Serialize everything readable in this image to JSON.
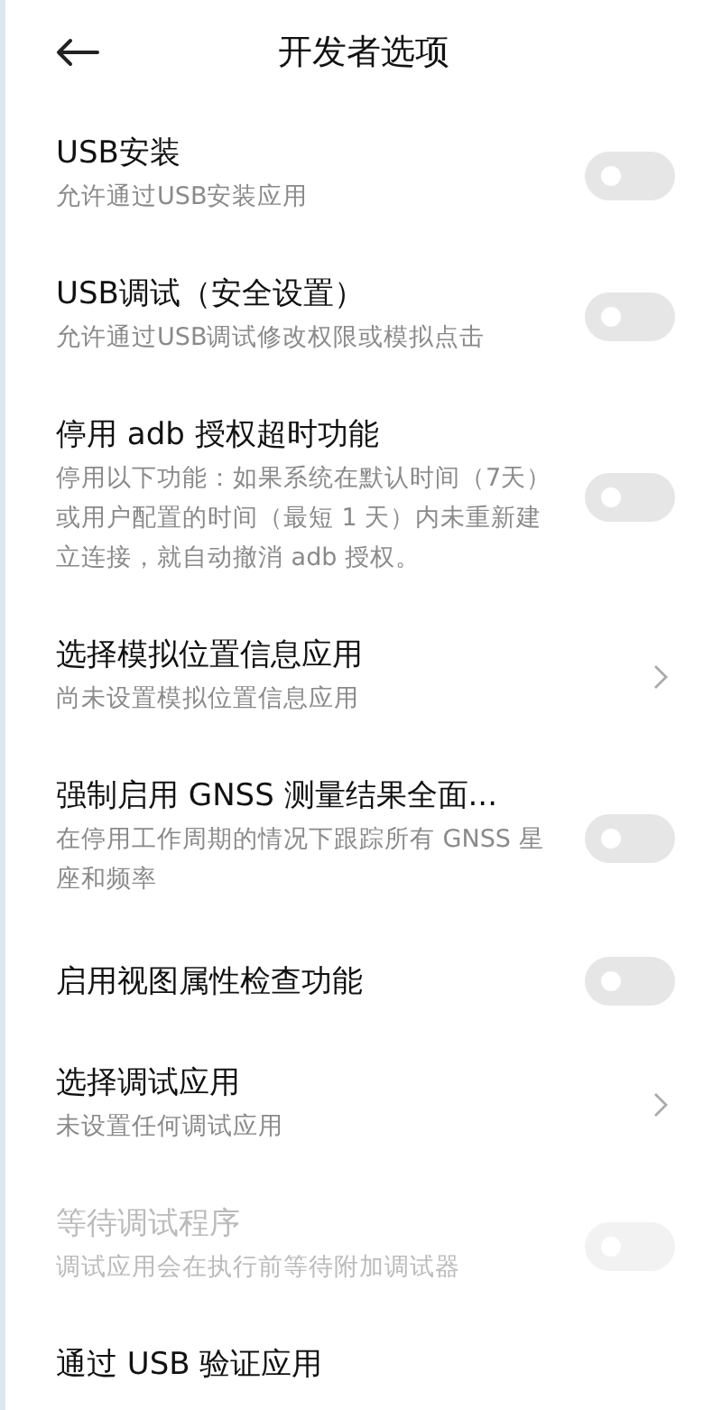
{
  "header": {
    "title": "开发者选项"
  },
  "items": [
    {
      "kind": "toggle",
      "title": "USB安装",
      "subtitle": "允许通过USB安装应用",
      "on": false,
      "disabled": false
    },
    {
      "kind": "toggle",
      "title": "USB调试（安全设置）",
      "subtitle": "允许通过USB调试修改权限或模拟点击",
      "on": false,
      "disabled": false
    },
    {
      "kind": "toggle",
      "title": "停用 adb 授权超时功能",
      "subtitle": "停用以下功能：如果系统在默认时间（7天）或用户配置的时间（最短 1 天）内未重新建立连接，就自动撤消 adb 授权。",
      "on": false,
      "disabled": false
    },
    {
      "kind": "link",
      "title": "选择模拟位置信息应用",
      "subtitle": "尚未设置模拟位置信息应用",
      "disabled": false
    },
    {
      "kind": "toggle",
      "title": "强制启用 GNSS 测量结果全面...",
      "subtitle": "在停用工作周期的情况下跟踪所有 GNSS 星座和频率",
      "on": false,
      "disabled": false
    },
    {
      "kind": "toggle",
      "title": "启用视图属性检查功能",
      "on": false,
      "disabled": false
    },
    {
      "kind": "link",
      "title": "选择调试应用",
      "subtitle": "未设置任何调试应用",
      "disabled": false
    },
    {
      "kind": "toggle",
      "title": "等待调试程序",
      "subtitle": "调试应用会在执行前等待附加调试器",
      "on": false,
      "disabled": true
    },
    {
      "kind": "plain",
      "title": "通过 USB 验证应用",
      "disabled": false
    }
  ]
}
